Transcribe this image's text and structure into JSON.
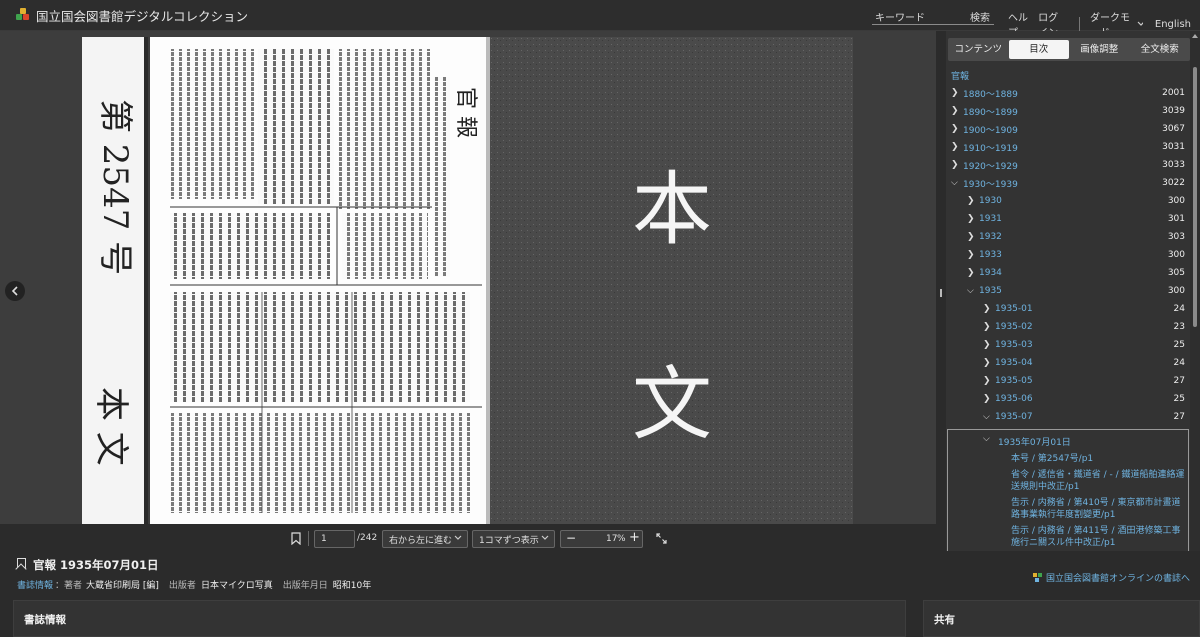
{
  "header": {
    "site_title": "国立国会図書館デジタルコレクション",
    "keyword_placeholder": "キーワード",
    "search_label": "検索",
    "help_label": "ヘルプ",
    "login_label": "ログイン",
    "dark_mode_label": "ダークモード",
    "language_label": "English"
  },
  "viewer": {
    "page_number": "1",
    "page_total": "/242",
    "direction": "右から左に進む",
    "display_mode": "1コマずつ表示",
    "zoom": "17",
    "zoom_unit": "%"
  },
  "page_scan": {
    "cover_left": "第 2547 号",
    "cover_bottom": "本 文",
    "gazette_title": "官 報",
    "big_char_top": "本",
    "big_char_bottom": "文"
  },
  "panel": {
    "tabs": [
      "コンテンツ",
      "目次",
      "画像調整",
      "全文検索"
    ],
    "active_tab": 1,
    "root": "官報",
    "decades": [
      {
        "label": "1880～1889",
        "count": "2001"
      },
      {
        "label": "1890～1899",
        "count": "3039"
      },
      {
        "label": "1900～1909",
        "count": "3067"
      },
      {
        "label": "1910～1919",
        "count": "3031"
      },
      {
        "label": "1920～1929",
        "count": "3033"
      },
      {
        "label": "1930～1939",
        "count": "3022"
      }
    ],
    "years": [
      {
        "label": "1930",
        "count": "300"
      },
      {
        "label": "1931",
        "count": "301"
      },
      {
        "label": "1932",
        "count": "303"
      },
      {
        "label": "1933",
        "count": "300"
      },
      {
        "label": "1934",
        "count": "305"
      },
      {
        "label": "1935",
        "count": "300"
      }
    ],
    "months": [
      {
        "label": "1935-01",
        "count": "24"
      },
      {
        "label": "1935-02",
        "count": "23"
      },
      {
        "label": "1935-03",
        "count": "25"
      },
      {
        "label": "1935-04",
        "count": "24"
      },
      {
        "label": "1935-05",
        "count": "27"
      },
      {
        "label": "1935-06",
        "count": "25"
      },
      {
        "label": "1935-07",
        "count": "27"
      }
    ],
    "day": "1935年07月01日",
    "items": [
      "本号 / 第2547号/p1",
      "省令 / 遞信省・鐵道省 / - / 鐵道船舶連絡運送規則中改正/p1",
      "告示 / 内務省 / 第410号 / 東京都市計畫道路事業執行年度割變更/p1",
      "告示 / 内務省 / 第411号 / 酒田港修築工事施行ニ關スル件中改正/p1"
    ]
  },
  "info": {
    "title": "官報 1935年07月01日",
    "bib_link": "書誌情報",
    "author_label": "：著者",
    "author_value": "大蔵省印刷局 [編]",
    "publisher_label": "出版者",
    "publisher_value": "日本マイクロ写真",
    "date_label": "出版年月日",
    "date_value": "昭和10年",
    "online_link": "国立国会図書館オンラインの書誌へ"
  },
  "sections": {
    "bib_title": "書誌情報",
    "share_title": "共有"
  }
}
